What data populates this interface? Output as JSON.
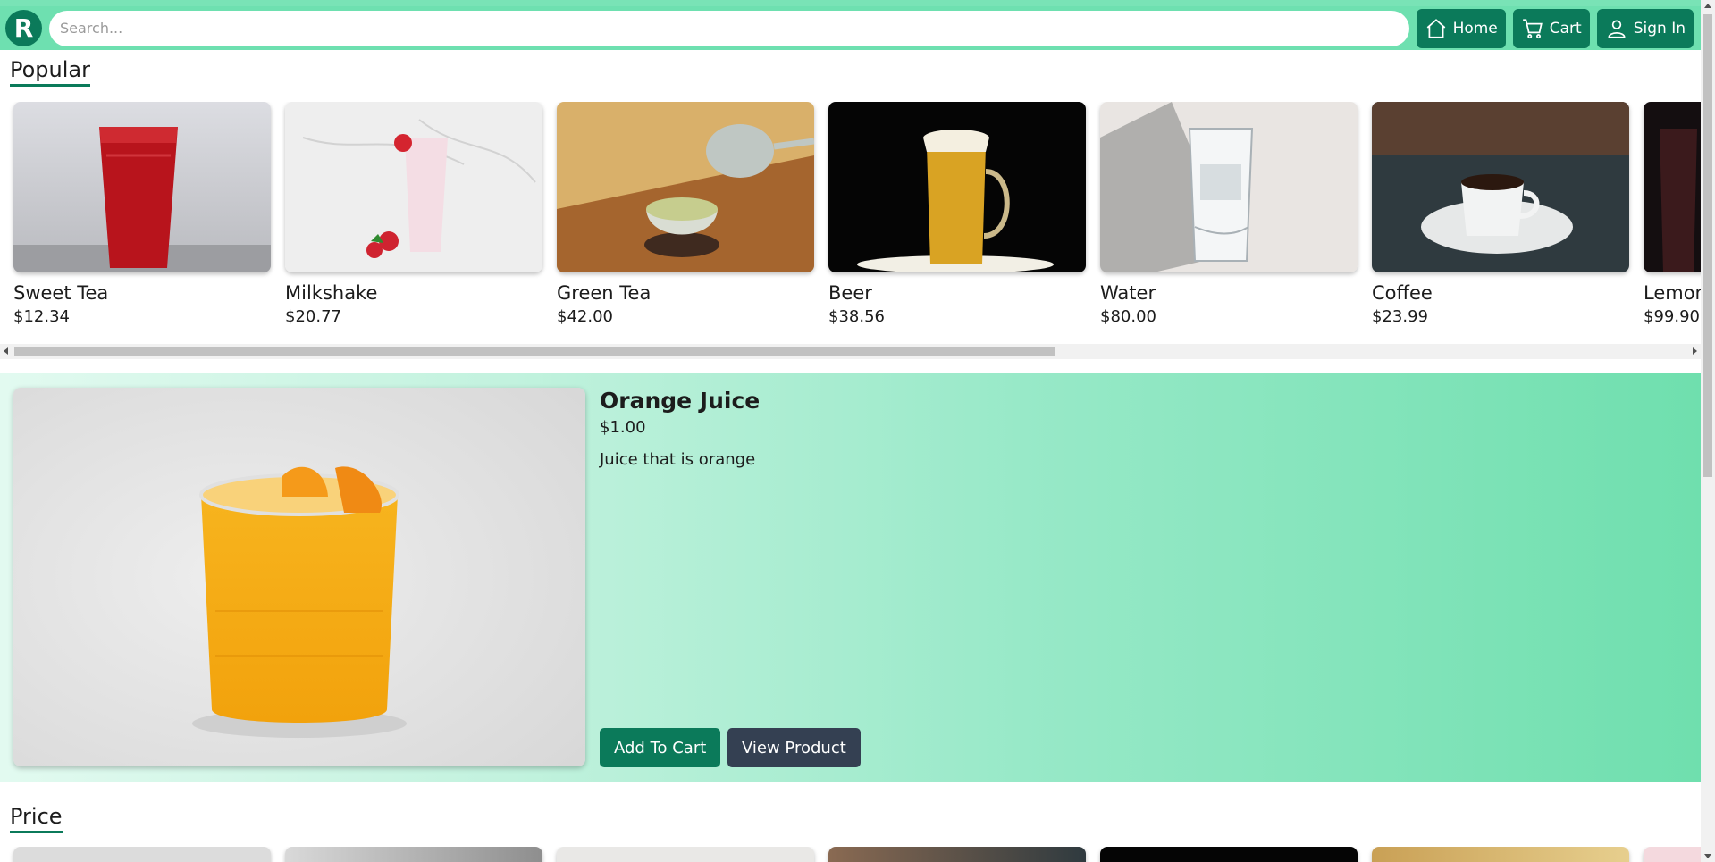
{
  "header": {
    "logo_letter": "R",
    "search_placeholder": "Search...",
    "nav": {
      "home_label": "Home",
      "cart_label": "Cart",
      "signin_label": "Sign In"
    }
  },
  "sections": {
    "popular_title": "Popular",
    "price_title": "Price"
  },
  "popular_items": [
    {
      "name": "Sweet Tea",
      "price": "$12.34"
    },
    {
      "name": "Milkshake",
      "price": "$20.77"
    },
    {
      "name": "Green Tea",
      "price": "$42.00"
    },
    {
      "name": "Beer",
      "price": "$38.56"
    },
    {
      "name": "Water",
      "price": "$80.00"
    },
    {
      "name": "Coffee",
      "price": "$23.99"
    },
    {
      "name": "Lemonade",
      "price": "$99.90"
    }
  ],
  "featured": {
    "name": "Orange Juice",
    "price": "$1.00",
    "description": "Juice that is orange",
    "add_to_cart_label": "Add To Cart",
    "view_product_label": "View Product"
  },
  "colors": {
    "brand": "#0b7a5a",
    "topbar": "#6ee0b0",
    "view_button": "#344052"
  }
}
